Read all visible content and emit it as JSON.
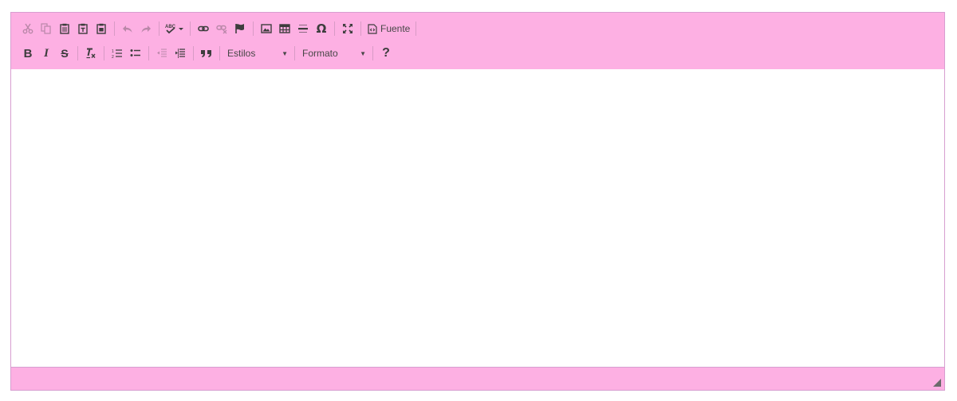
{
  "toolbar": {
    "source_label": "Fuente",
    "styles_label": "Estilos",
    "format_label": "Formato",
    "bold_glyph": "B",
    "italic_glyph": "I",
    "strike_glyph": "S",
    "help_glyph": "?",
    "omega_glyph": "Ω",
    "row1_icons": [
      "cut-icon",
      "copy-icon",
      "paste-icon",
      "paste-text-icon",
      "paste-word-icon",
      "undo-icon",
      "redo-icon",
      "spellcheck-icon",
      "link-icon",
      "unlink-icon",
      "anchor-icon",
      "image-icon",
      "table-icon",
      "horizontal-rule-icon",
      "special-char-icon",
      "maximize-icon",
      "source-icon"
    ],
    "row2_icons": [
      "bold-icon",
      "italic-icon",
      "strike-icon",
      "remove-format-icon",
      "numbered-list-icon",
      "bulleted-list-icon",
      "outdent-icon",
      "indent-icon",
      "blockquote-icon",
      "help-icon"
    ]
  },
  "colors": {
    "toolbar_bg": "#fdb0e3",
    "border": "#d79ed0",
    "icon": "#3d3d3d",
    "content_bg": "#ffffff"
  }
}
